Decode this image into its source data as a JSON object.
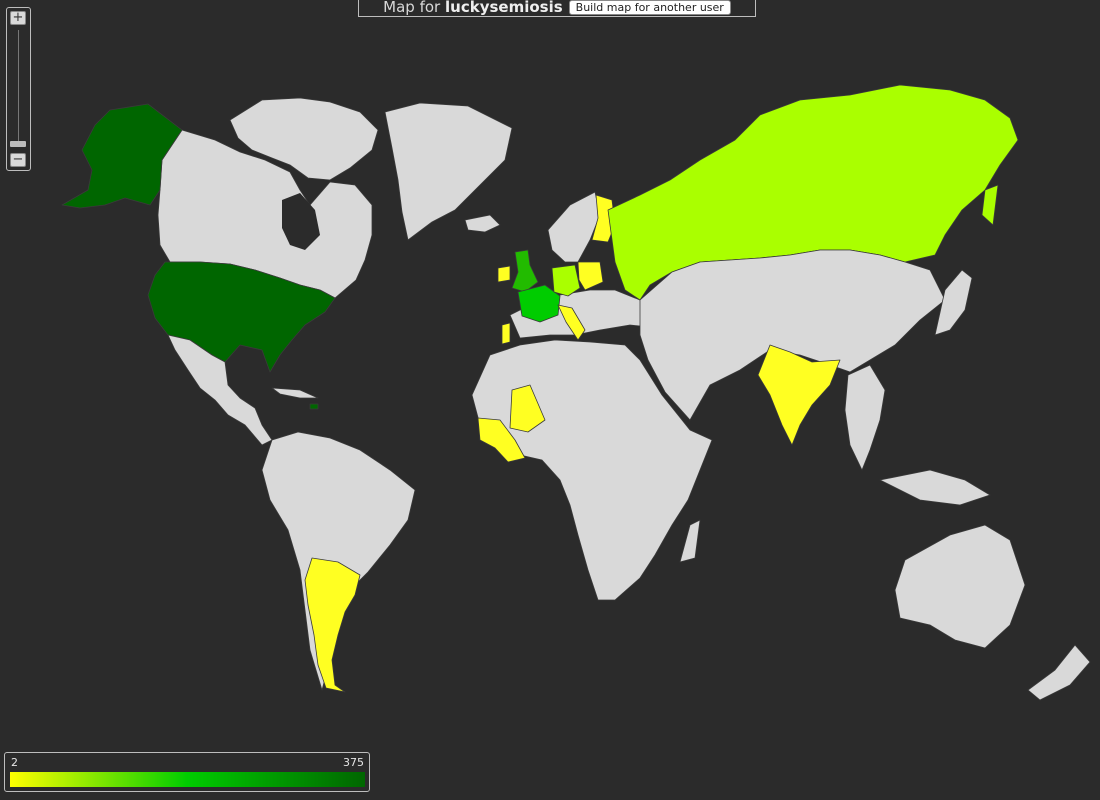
{
  "header": {
    "title_prefix": "Map for",
    "username": "luckysemiosis",
    "button_label": "Build map for another user"
  },
  "zoom": {
    "in_label": "+",
    "out_label": "−"
  },
  "legend": {
    "min": "2",
    "max": "375",
    "colors": [
      "#ffff00",
      "#00cc00",
      "#006600"
    ]
  },
  "colors": {
    "background": "#2b2b2b",
    "no_data": "#d9d9d9",
    "borders": "#3a3a3a"
  },
  "highlighted_regions": [
    {
      "name": "alaska",
      "level": "high",
      "color": "#006600"
    },
    {
      "name": "usa",
      "level": "high",
      "color": "#006600"
    },
    {
      "name": "uk",
      "level": "mid",
      "color": "#22bb00"
    },
    {
      "name": "france",
      "level": "mid",
      "color": "#00cc00"
    },
    {
      "name": "russia",
      "level": "low-mid",
      "color": "#aaff00"
    },
    {
      "name": "germany",
      "level": "low-mid",
      "color": "#aaff00"
    },
    {
      "name": "finland",
      "level": "low",
      "color": "#ffff22"
    },
    {
      "name": "poland",
      "level": "low",
      "color": "#ffff22"
    },
    {
      "name": "italy",
      "level": "low",
      "color": "#ffff22"
    },
    {
      "name": "india",
      "level": "low",
      "color": "#ffff22"
    },
    {
      "name": "argentina",
      "level": "low",
      "color": "#ffff22"
    },
    {
      "name": "mali",
      "level": "low",
      "color": "#ffff22"
    }
  ]
}
